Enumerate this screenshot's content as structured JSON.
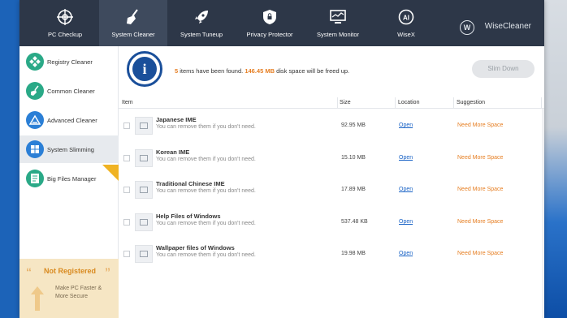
{
  "nav": {
    "items": [
      {
        "label": "PC Checkup",
        "icon": "target-icon"
      },
      {
        "label": "System Cleaner",
        "icon": "broom-icon"
      },
      {
        "label": "System Tuneup",
        "icon": "rocket-icon"
      },
      {
        "label": "Privacy Protector",
        "icon": "shield-lock-icon"
      },
      {
        "label": "System Monitor",
        "icon": "monitor-icon"
      },
      {
        "label": "WiseX",
        "icon": "ai-icon"
      }
    ],
    "active_index": 1,
    "brand": "WiseCleaner",
    "brand_logo_letter": "W"
  },
  "sidebar": {
    "items": [
      {
        "label": "Registry Cleaner",
        "icon": "registry-icon"
      },
      {
        "label": "Common Cleaner",
        "icon": "broom-icon"
      },
      {
        "label": "Advanced Cleaner",
        "icon": "advanced-clean-icon"
      },
      {
        "label": "System Slimming",
        "icon": "windows-icon"
      },
      {
        "label": "Big Files Manager",
        "icon": "files-icon"
      }
    ],
    "active_index": 3
  },
  "promo": {
    "title": "Not Registered",
    "line1": "Make PC Faster &",
    "line2": "More Secure"
  },
  "summary": {
    "count": "5",
    "text1": " items have been found. ",
    "size": "146.45 MB",
    "text2": " disk space will be freed up.",
    "button_label": "Slim Down",
    "info_glyph": "i"
  },
  "table": {
    "headers": {
      "item": "Item",
      "size": "Size",
      "location": "Location",
      "suggestion": "Suggestion"
    },
    "rows": [
      {
        "name": "Japanese IME",
        "desc": "You can remove them if you don't need.",
        "size": "92.95 MB",
        "location": "Open",
        "suggestion": "Need More Space"
      },
      {
        "name": "Korean IME",
        "desc": "You can remove them if you don't need.",
        "size": "15.10 MB",
        "location": "Open",
        "suggestion": "Need More Space"
      },
      {
        "name": "Traditional Chinese IME",
        "desc": "You can remove them if you don't need.",
        "size": "17.89 MB",
        "location": "Open",
        "suggestion": "Need More Space"
      },
      {
        "name": "Help Files of Windows",
        "desc": "You can remove them if you don't need.",
        "size": "537.48 KB",
        "location": "Open",
        "suggestion": "Need More Space"
      },
      {
        "name": "Wallpaper files of Windows",
        "desc": "You can remove them if you don't need.",
        "size": "19.98 MB",
        "location": "Open",
        "suggestion": "Need More Space"
      }
    ]
  },
  "colors": {
    "accent": "#e67e22",
    "topbar": "#2d3748",
    "link": "#1a63c6",
    "green": "#2aa987"
  }
}
